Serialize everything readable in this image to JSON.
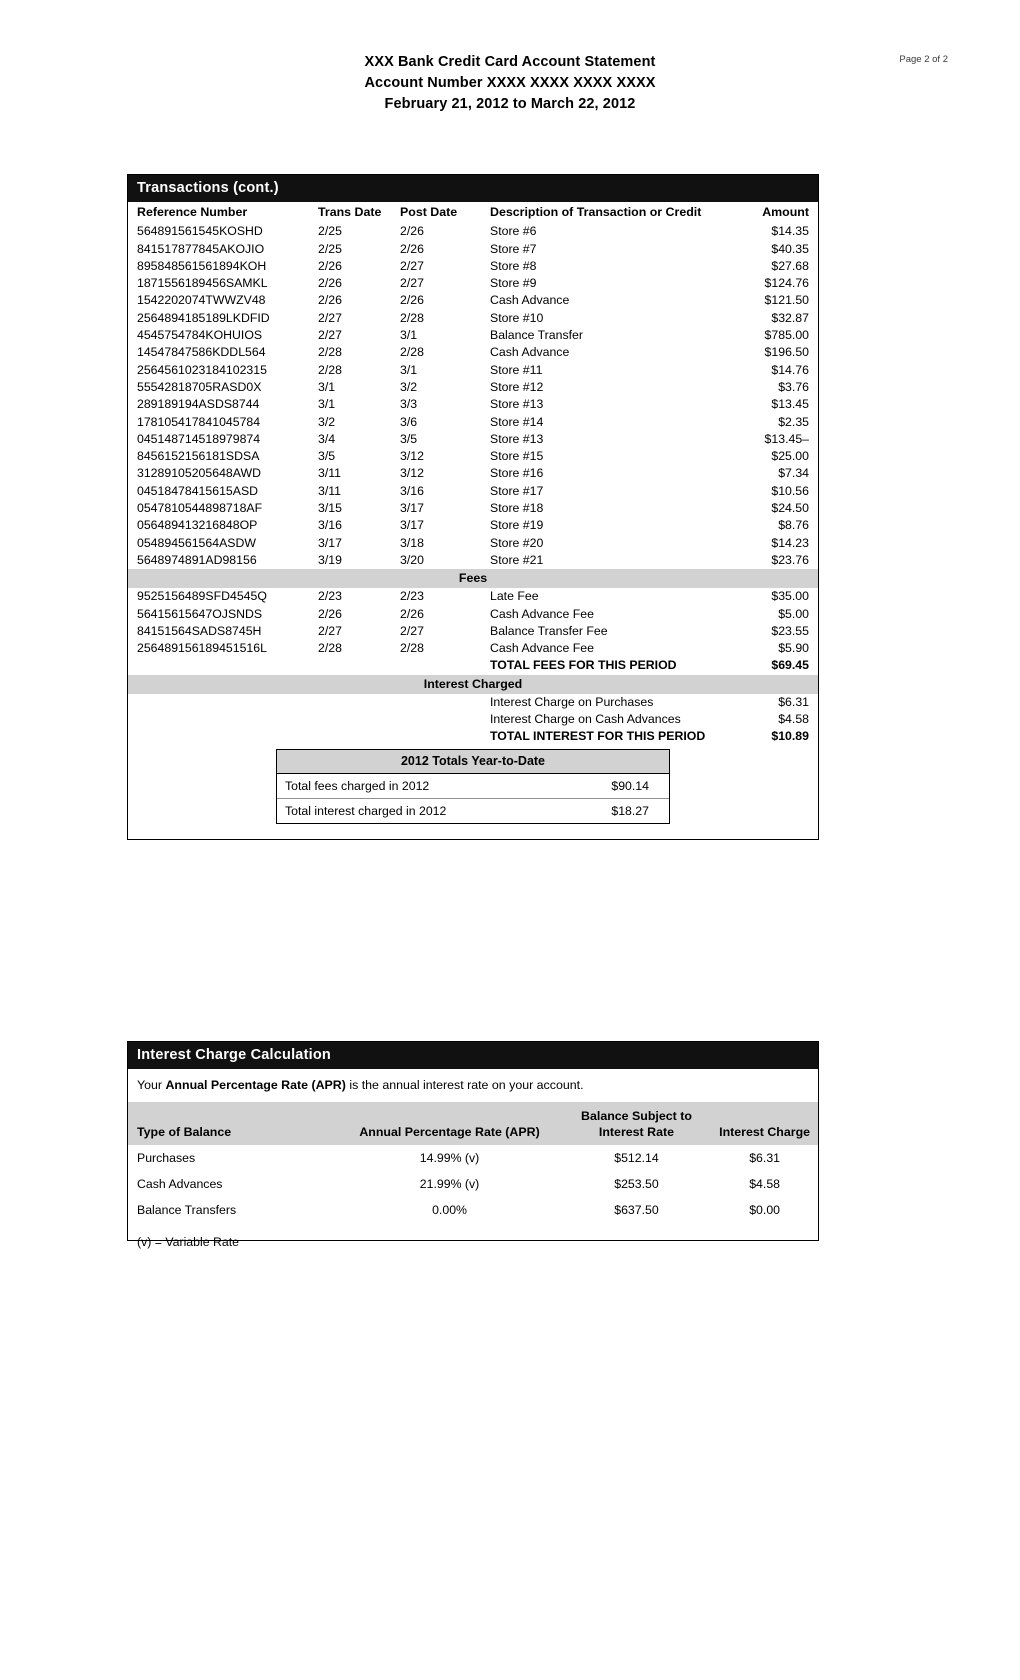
{
  "header": {
    "line1": "XXX Bank Credit Card Account Statement",
    "line2": "Account Number XXXX XXXX XXXX XXXX",
    "line3": "February 21, 2012 to March 22, 2012",
    "page_indicator": "Page 2 of 2"
  },
  "transactions": {
    "title": "Transactions (cont.)",
    "columns": {
      "reference": "Reference Number",
      "trans_date": "Trans Date",
      "post_date": "Post Date",
      "description": "Description of Transaction or Credit",
      "amount": "Amount"
    },
    "rows": [
      {
        "ref": "564891561545KOSHD",
        "trans": "2/25",
        "post": "2/26",
        "desc": "Store #6",
        "amt": "$14.35"
      },
      {
        "ref": "841517877845AKOJIO",
        "trans": "2/25",
        "post": "2/26",
        "desc": "Store #7",
        "amt": "$40.35"
      },
      {
        "ref": "895848561561894KOH",
        "trans": "2/26",
        "post": "2/27",
        "desc": "Store #8",
        "amt": "$27.68"
      },
      {
        "ref": "1871556189456SAMKL",
        "trans": "2/26",
        "post": "2/27",
        "desc": "Store #9",
        "amt": "$124.76"
      },
      {
        "ref": "1542202074TWWZV48",
        "trans": "2/26",
        "post": "2/26",
        "desc": "Cash Advance",
        "amt": "$121.50"
      },
      {
        "ref": "2564894185189LKDFID",
        "trans": "2/27",
        "post": "2/28",
        "desc": "Store #10",
        "amt": "$32.87"
      },
      {
        "ref": "4545754784KOHUIOS",
        "trans": "2/27",
        "post": "3/1",
        "desc": "Balance Transfer",
        "amt": "$785.00"
      },
      {
        "ref": "14547847586KDDL564",
        "trans": "2/28",
        "post": "2/28",
        "desc": "Cash Advance",
        "amt": "$196.50"
      },
      {
        "ref": "2564561023184102315",
        "trans": "2/28",
        "post": "3/1",
        "desc": "Store #11",
        "amt": "$14.76"
      },
      {
        "ref": "55542818705RASD0X",
        "trans": "3/1",
        "post": "3/2",
        "desc": "Store #12",
        "amt": "$3.76"
      },
      {
        "ref": "289189194ASDS8744",
        "trans": "3/1",
        "post": "3/3",
        "desc": "Store #13",
        "amt": "$13.45"
      },
      {
        "ref": "178105417841045784",
        "trans": "3/2",
        "post": "3/6",
        "desc": "Store #14",
        "amt": "$2.35"
      },
      {
        "ref": "045148714518979874",
        "trans": "3/4",
        "post": "3/5",
        "desc": "Store #13",
        "amt": "$13.45–"
      },
      {
        "ref": "8456152156181SDSA",
        "trans": "3/5",
        "post": "3/12",
        "desc": "Store #15",
        "amt": "$25.00"
      },
      {
        "ref": "31289105205648AWD",
        "trans": "3/11",
        "post": "3/12",
        "desc": "Store #16",
        "amt": "$7.34"
      },
      {
        "ref": "04518478415615ASD",
        "trans": "3/11",
        "post": "3/16",
        "desc": "Store #17",
        "amt": "$10.56"
      },
      {
        "ref": "0547810544898718AF",
        "trans": "3/15",
        "post": "3/17",
        "desc": "Store #18",
        "amt": "$24.50"
      },
      {
        "ref": "056489413216848OP",
        "trans": "3/16",
        "post": "3/17",
        "desc": "Store #19",
        "amt": "$8.76"
      },
      {
        "ref": "054894561564ASDW",
        "trans": "3/17",
        "post": "3/18",
        "desc": "Store #20",
        "amt": "$14.23"
      },
      {
        "ref": "5648974891AD98156",
        "trans": "3/19",
        "post": "3/20",
        "desc": "Store #21",
        "amt": "$23.76"
      }
    ],
    "fees_band": "Fees",
    "fees_rows": [
      {
        "ref": "9525156489SFD4545Q",
        "trans": "2/23",
        "post": "2/23",
        "desc": "Late Fee",
        "amt": "$35.00"
      },
      {
        "ref": "56415615647OJSNDS",
        "trans": "2/26",
        "post": "2/26",
        "desc": "Cash Advance Fee",
        "amt": "$5.00"
      },
      {
        "ref": "84151564SADS8745H",
        "trans": "2/27",
        "post": "2/27",
        "desc": "Balance Transfer Fee",
        "amt": "$23.55"
      },
      {
        "ref": "256489156189451516L",
        "trans": "2/28",
        "post": "2/28",
        "desc": "Cash Advance Fee",
        "amt": "$5.90"
      }
    ],
    "fees_total_label": "TOTAL FEES FOR THIS PERIOD",
    "fees_total_amount": "$69.45",
    "interest_band": "Interest Charged",
    "interest_rows": [
      {
        "desc": "Interest Charge on Purchases",
        "amt": "$6.31"
      },
      {
        "desc": "Interest Charge on Cash Advances",
        "amt": "$4.58"
      }
    ],
    "interest_total_label": "TOTAL INTEREST FOR THIS PERIOD",
    "interest_total_amount": "$10.89"
  },
  "ytd": {
    "title": "2012 Totals Year-to-Date",
    "rows": [
      {
        "label": "Total fees charged in 2012",
        "value": "$90.14"
      },
      {
        "label": "Total interest charged in 2012",
        "value": "$18.27"
      }
    ]
  },
  "interest_calc": {
    "title": "Interest Charge Calculation",
    "intro_prefix": "Your ",
    "intro_bold": "Annual Percentage Rate (APR)",
    "intro_suffix": " is the annual interest rate on your account.",
    "columns": {
      "type": "Type of Balance",
      "apr": "Annual Percentage Rate (APR)",
      "balance_l1": "Balance Subject to",
      "balance_l2": "Interest Rate",
      "charge": "Interest Charge"
    },
    "rows": [
      {
        "type": "Purchases",
        "apr": "14.99% (v)",
        "balance": "$512.14",
        "charge": "$6.31"
      },
      {
        "type": "Cash Advances",
        "apr": "21.99% (v)",
        "balance": "$253.50",
        "charge": "$4.58"
      },
      {
        "type": "Balance Transfers",
        "apr": "0.00%",
        "balance": "$637.50",
        "charge": "$0.00"
      }
    ],
    "footnote": "(v) = Variable Rate"
  }
}
